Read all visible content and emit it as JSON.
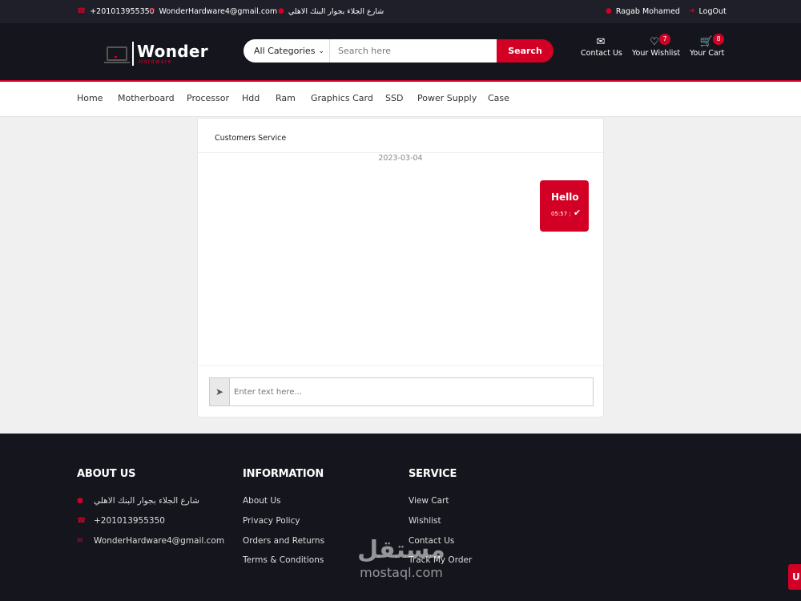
{
  "topbar": {
    "phone": "+201013955350",
    "email": "WonderHardware4@gmail.com",
    "address": "شارع الجلاء بجوار البنك الاهلي",
    "user": "Ragab Mohamed",
    "logout": "LogOut"
  },
  "header": {
    "brand": "Wonder",
    "brand_sub": "Hardware",
    "search": {
      "category": "All Categories",
      "placeholder": "Search here",
      "button": "Search"
    },
    "icons": {
      "contact": "Contact Us",
      "wishlist": "Your Wishlist",
      "wishlist_count": "7",
      "cart": "Your Cart",
      "cart_count": "8"
    }
  },
  "nav": [
    "Home",
    "Motherboard",
    "Processor",
    "Hdd",
    "Ram",
    "Graphics Card",
    "SSD",
    "Power Supply",
    "Case"
  ],
  "chat": {
    "title": "Customers Service",
    "date": "2023-03-04",
    "message": {
      "text": "Hello",
      "time": "05:57 ;"
    },
    "input_placeholder": "Enter text here..."
  },
  "footer": {
    "about": {
      "heading": "ABOUT US",
      "address": "شارع الجلاء بجوار البنك الاهلي",
      "phone": "+201013955350",
      "email": "WonderHardware4@gmail.com"
    },
    "information": {
      "heading": "INFORMATION",
      "links": [
        "About Us",
        "Privacy Policy",
        "Orders and Returns",
        "Terms & Conditions"
      ]
    },
    "service": {
      "heading": "SERVICE",
      "links": [
        "View Cart",
        "Wishlist",
        "Contact Us",
        "Track My Order"
      ]
    }
  },
  "watermark": {
    "arabic": "مستقل",
    "latin": "mostaql.com"
  },
  "floating_button": "U",
  "colors": {
    "accent": "#d10024",
    "header_bg": "#15161d",
    "topbar_bg": "#1e1f29"
  }
}
